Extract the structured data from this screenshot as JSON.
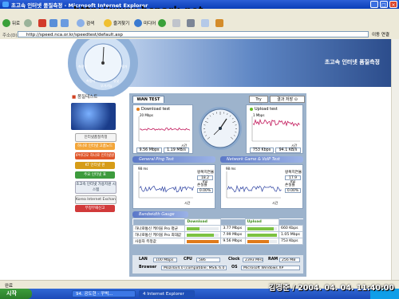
{
  "window": {
    "title": "초고속 인터넷 품질측정 - Microsoft Internet Explorer",
    "watermark": "http://www.bcpark.net"
  },
  "toolbar": {
    "back_label": "뒤로",
    "search_label": "검색",
    "favorites_label": "즐겨찾기",
    "media_label": "미디어"
  },
  "address": {
    "label": "주소(D)",
    "url": "http://speed.nca.or.kr/speedtest/default.asp",
    "go_label": "이동",
    "links_label": "연결"
  },
  "banner": {
    "title": "초고속 인터넷 품질측정",
    "dial_labels": [
      "측정단",
      "측정자",
      "부가기능",
      "유닛",
      "평가"
    ]
  },
  "sidebar": {
    "title": "품질테스트",
    "buttons": [
      "인터넷품질측정",
      "하나로 인터넷 고품노드",
      "IP비디오 하나로 인터넷원",
      "KT 인터넷 원",
      "주요 인터넷 표",
      "초고속 인터넷 가용지원 시스템",
      "Korea Internet Exchange",
      "부정부패신고"
    ]
  },
  "test": {
    "tab_label": "WAN TEST",
    "try_again": "Try again",
    "save_result": "결과 저장 ⊙",
    "download": {
      "title": "Download test",
      "scale": "20 Mbps",
      "axis": "시간",
      "mbps": "9.56 Mbps",
      "mbytes": "1.19 MB/s"
    },
    "upload": {
      "title": "Upload test",
      "scale": "1 Mbps",
      "axis": "시간",
      "kbps": "753 Kbps",
      "kbytes": "94.1 KB/s"
    },
    "ping_section": "General Ping Test",
    "netgame_section": "Network Game & VoIP Test",
    "ping": {
      "scale": "98 ms",
      "rtt_label": "왕복지연율",
      "rtt": "18.2 ms",
      "loss_label": "손실률",
      "loss": "0.00%",
      "axis": "시간"
    },
    "netgame": {
      "scale": "98 ms",
      "rtt_label": "왕복지연율",
      "rtt": "17.9 ms",
      "loss_label": "손실률",
      "loss": "0.00%",
      "axis": "시간"
    },
    "bw_section": "Bandwidth Gauge",
    "bw_headers": [
      "Download",
      "Upload"
    ],
    "bw_rows": [
      {
        "label": "하나로통신 케이블 Pro 평균",
        "down": "3.77 Mbps",
        "up": "660 Kbps",
        "down_frac": 0.39,
        "up_frac": 0.88
      },
      {
        "label": "하나로통신 케이블 Pro 최대값",
        "down": "7.99 Mbps",
        "up": "1.05 Mbps",
        "down_frac": 0.84,
        "up_frac": 1.0
      },
      {
        "label": "사용자 측정값",
        "down": "9.56 Mbps",
        "up": "753 Kbps",
        "down_frac": 1.0,
        "up_frac": 0.72
      }
    ]
  },
  "sysinfo": {
    "lan_label": "LAN",
    "lan": "100 Mbps",
    "cpu_label": "CPU",
    "cpu": "586",
    "clock_label": "Clock",
    "clock": "2393 MHz",
    "ram_label": "RAM",
    "ram": "256 MB",
    "browser_label": "Browser",
    "browser": "Mozilla/4.0 (compatible; MSIE 6.0",
    "os_label": "OS",
    "os": "Microsoft Windows XP"
  },
  "status": {
    "text": "완료"
  },
  "taskbar": {
    "start": "시작",
    "tasks": [
      "94. 공도현 - 꾸벅...",
      "4 Internet Explorer"
    ]
  },
  "stamp": "김경준 / 2004. 04. 04. 11:40:00",
  "colors": {
    "download": "#e07a1a",
    "upload": "#66bb22",
    "accent": "#5b78c8"
  }
}
